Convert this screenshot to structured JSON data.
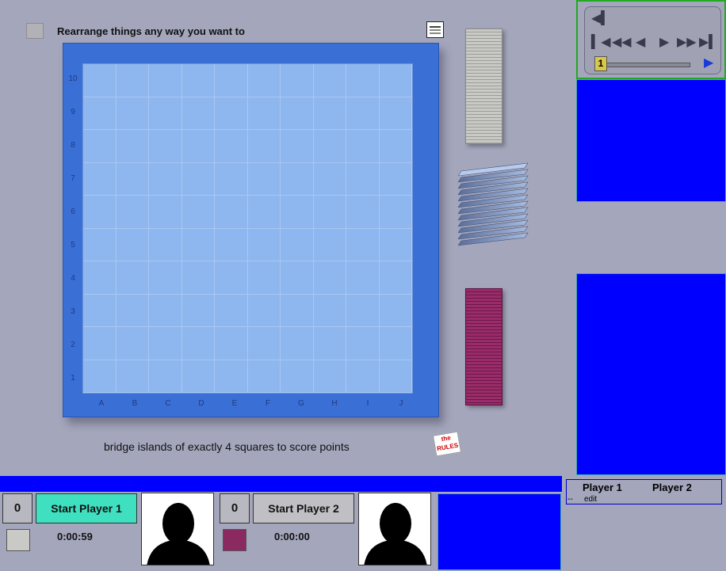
{
  "header": {
    "instruction": "Rearrange things any way you want to",
    "notes_icon": "notes-icon"
  },
  "board": {
    "row_labels": [
      "10",
      "9",
      "8",
      "7",
      "6",
      "5",
      "4",
      "3",
      "2",
      "1"
    ],
    "col_labels": [
      "A",
      "B",
      "C",
      "D",
      "E",
      "F",
      "G",
      "H",
      "I",
      "J"
    ]
  },
  "hint": "bridge islands of exactly 4 squares to score points",
  "rules_icon_text": "the RULES",
  "replay": {
    "buttons": [
      "step-back-icon",
      "first-icon",
      "fast-back-icon",
      "back-icon",
      "play-icon",
      "fast-forward-icon",
      "last-icon",
      "play-blue-icon"
    ],
    "position": "1"
  },
  "players": [
    {
      "score": "0",
      "start_label": "Start Player 1",
      "timer": "0:00:59",
      "color": "#3fe0c0",
      "chip_color": "#c9c9c6"
    },
    {
      "score": "0",
      "start_label": "Start Player 2",
      "timer": "0:00:00",
      "color": "#c0c0c4",
      "chip_color": "#8a2a60"
    }
  ],
  "score_table": {
    "col1": "Player 1",
    "col2": "Player 2",
    "row_prefix": "--",
    "row_edit": "edit"
  },
  "colors": {
    "board": "#3a6fd6",
    "panel_blue": "#0000ff",
    "background": "#a4a6bc"
  }
}
